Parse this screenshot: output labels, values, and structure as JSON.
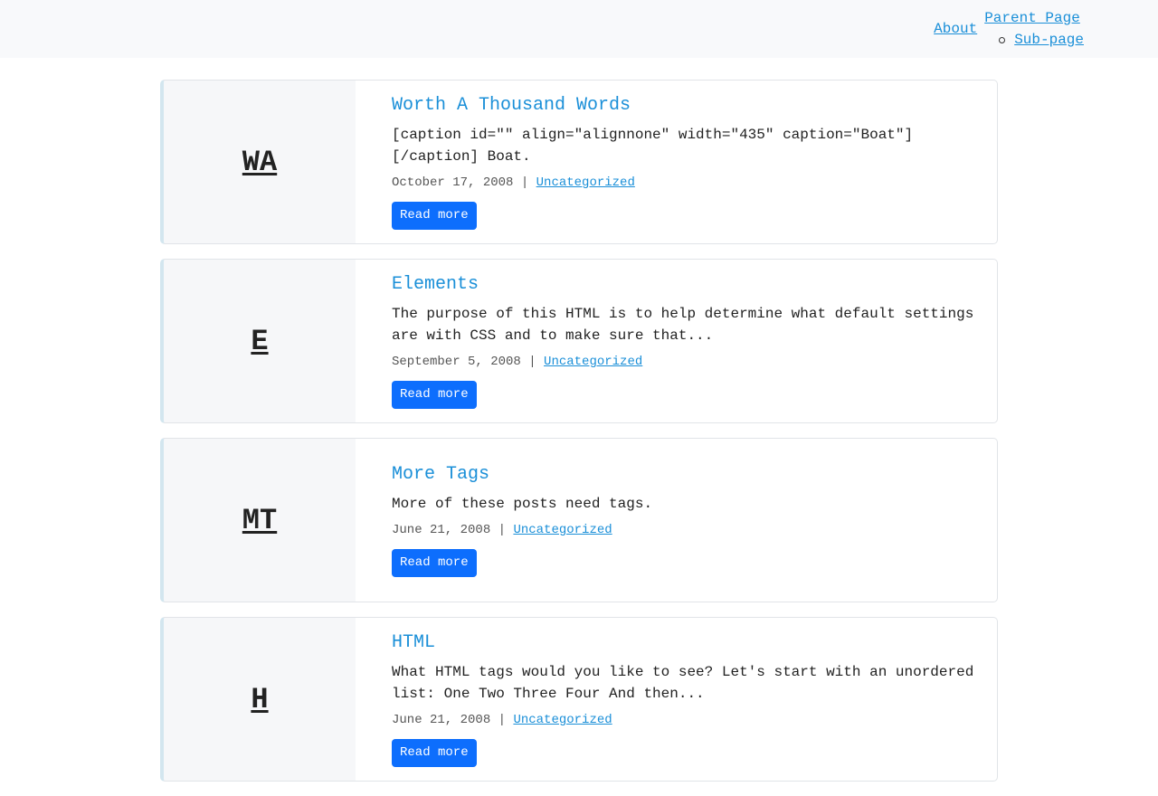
{
  "nav": {
    "about": "About",
    "parent": "Parent Page",
    "sub": "Sub-page"
  },
  "posts": [
    {
      "initials": "WA",
      "title": "Worth A Thousand Words",
      "excerpt": "[caption id=\"\" align=\"alignnone\" width=\"435\" caption=\"Boat\"] [/caption] Boat.",
      "date": "October 17, 2008",
      "category": "Uncategorized",
      "button": "Read more"
    },
    {
      "initials": "E",
      "title": "Elements",
      "excerpt": "The purpose of this HTML is to help determine what default settings are with CSS and to make sure that...",
      "date": "September 5, 2008",
      "category": "Uncategorized",
      "button": "Read more"
    },
    {
      "initials": "MT",
      "title": "More Tags",
      "excerpt": "More of these posts need tags.",
      "date": "June 21, 2008",
      "category": "Uncategorized",
      "button": "Read more"
    },
    {
      "initials": "H",
      "title": "HTML",
      "excerpt": "What HTML tags would you like to see? Let's start with an unordered list: One Two Three Four And then...",
      "date": "June 21, 2008",
      "category": "Uncategorized",
      "button": "Read more"
    }
  ],
  "meta_separator": "|"
}
